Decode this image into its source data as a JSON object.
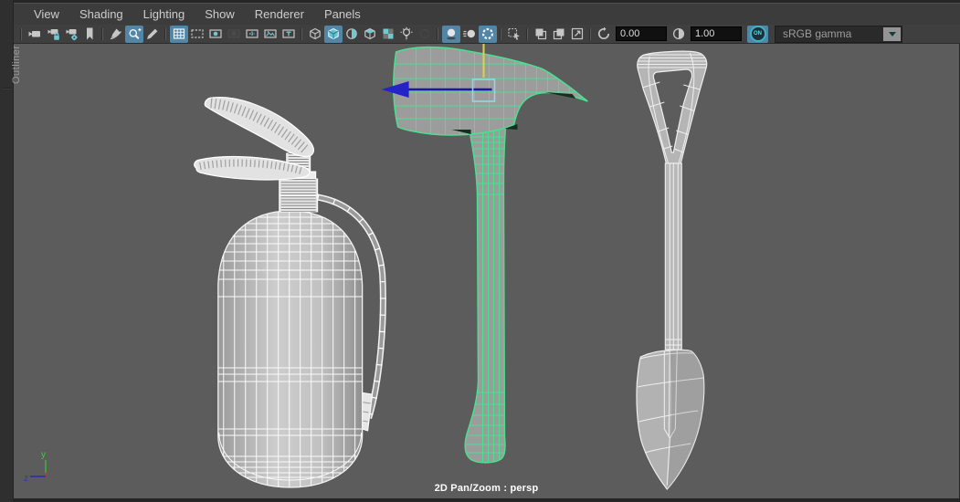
{
  "panel": {
    "outliner_label": "Outliner"
  },
  "menu_bar": {
    "items": [
      "View",
      "Shading",
      "Lighting",
      "Show",
      "Renderer",
      "Panels"
    ]
  },
  "toolbar": {
    "sections": [
      [
        {
          "name": "select-camera-button",
          "icon": "i-camera"
        },
        {
          "name": "lock-camera-button",
          "icon": "i-camera-lock"
        },
        {
          "name": "camera-attributes-button",
          "icon": "i-camera-gear"
        },
        {
          "name": "bookmarks-button",
          "icon": "i-bookmark"
        }
      ],
      [
        {
          "name": "grease-pencil-button",
          "icon": "i-grease"
        },
        {
          "name": "pan-zoom-tool-button",
          "icon": "i-panzoom",
          "active": true
        },
        {
          "name": "annotate-pencil-button",
          "icon": "i-pencil"
        }
      ],
      [
        {
          "name": "grid-toggle-button",
          "icon": "i-grid",
          "active": true
        },
        {
          "name": "film-gate-button",
          "icon": "i-filmgate"
        },
        {
          "name": "resolution-gate-button",
          "icon": "i-resgate"
        },
        {
          "name": "gate-mask-button",
          "icon": "i-gatemask",
          "dim": true
        },
        {
          "name": "field-chart-button",
          "icon": "i-fieldchart"
        },
        {
          "name": "image-plane-button",
          "icon": "i-imageplane"
        },
        {
          "name": "hud-toggle-button",
          "icon": "i-hud"
        }
      ],
      [
        {
          "name": "wireframe-display-button",
          "icon": "i-cubewire"
        },
        {
          "name": "smooth-shade-button",
          "icon": "i-cubeshaded",
          "active": true
        },
        {
          "name": "wireframe-on-shaded-button",
          "icon": "i-spherehalf"
        },
        {
          "name": "textured-display-button",
          "icon": "i-cubetex"
        },
        {
          "name": "default-material-button",
          "icon": "i-checker"
        },
        {
          "name": "lights-button",
          "icon": "i-bulb"
        },
        {
          "name": "shadows-button",
          "icon": "i-shadows",
          "dim": true
        }
      ],
      [
        {
          "name": "ambient-occlusion-button",
          "icon": "i-ao",
          "active": true
        },
        {
          "name": "motion-blur-button",
          "icon": "i-motionblur"
        },
        {
          "name": "anti-aliasing-button",
          "icon": "i-antialias",
          "active": true
        }
      ],
      [
        {
          "name": "isolate-select-button",
          "icon": "i-select"
        }
      ],
      [
        {
          "name": "previous-view-button",
          "icon": "i-prevview"
        },
        {
          "name": "next-view-button",
          "icon": "i-nextview"
        },
        {
          "name": "viewport-snapshot-button",
          "icon": "i-snapshot"
        }
      ]
    ],
    "exposure_value": "0.00",
    "gamma_value": "1.00",
    "on_toggle_label": "ON",
    "view_transform": "sRGB gamma"
  },
  "viewport": {
    "hud_text": "2D Pan/Zoom : persp",
    "axis": {
      "y_label": "y",
      "z_label": "z"
    },
    "objects": [
      {
        "name": "fire-extinguisher",
        "style": "white-wireframe"
      },
      {
        "name": "fire-axe",
        "style": "selected-green-wireframe"
      },
      {
        "name": "shovel",
        "style": "white-wireframe"
      }
    ],
    "colors": {
      "background": "#5c5c5c",
      "wireframe": "#f2f2f2",
      "selected_wireframe": "#49e190",
      "face_gray": "#9c9c9c",
      "manipulator_blue": "#2323c8",
      "manipulator_yellow": "#e4cf4a",
      "manipulator_square": "#8fd8ea",
      "active_button": "#5285a6",
      "icon_accent": "#6fc9d2"
    }
  }
}
